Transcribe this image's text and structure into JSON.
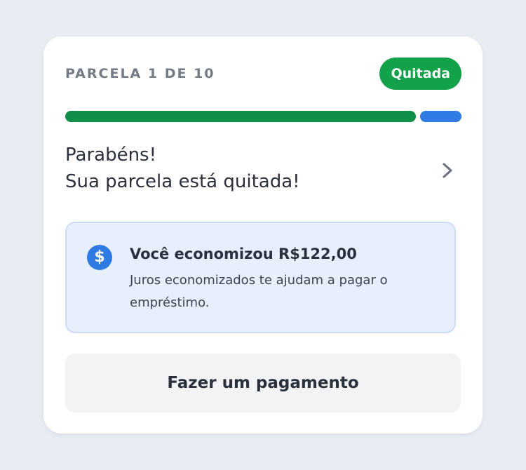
{
  "header": {
    "installment_label": "PARCELA 1 DE 10",
    "status_badge": "Quitada"
  },
  "progress": {
    "paid_fraction": 0.885,
    "saved_fraction": 0.104,
    "paid_color": "#0e9048",
    "saved_color": "#2f7be3"
  },
  "message": {
    "line1": "Parabéns!",
    "line2": "Sua parcela está quitada!",
    "chevron_icon": "chevron-right-icon"
  },
  "savings": {
    "icon": "dollar-icon",
    "icon_glyph": "$",
    "title": "Você economizou R$122,00",
    "description": "Juros economizados te ajudam a pagar o empréstimo."
  },
  "actions": {
    "pay_button_label": "Fazer um pagamento"
  },
  "colors": {
    "accent_green": "#13a14a",
    "accent_blue": "#2f7be3",
    "background": "#e8ecf3"
  }
}
